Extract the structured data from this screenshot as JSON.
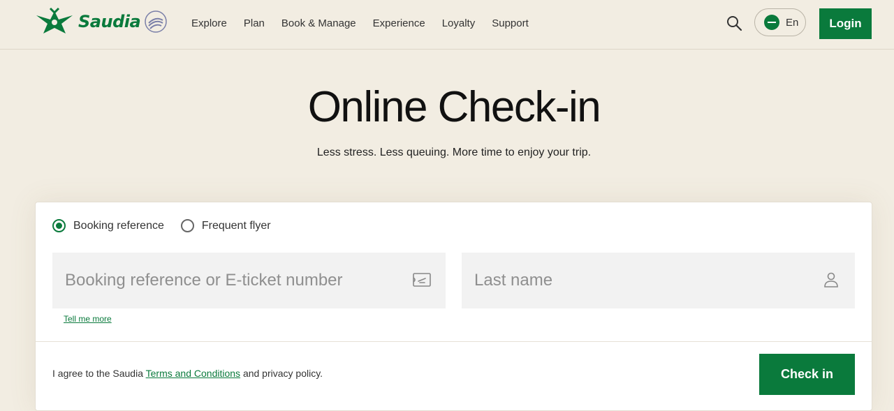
{
  "header": {
    "brand": "Saudia",
    "nav": [
      "Explore",
      "Plan",
      "Book & Manage",
      "Experience",
      "Loyalty",
      "Support"
    ],
    "language": "En",
    "login_label": "Login"
  },
  "hero": {
    "title": "Online Check-in",
    "subtitle": "Less stress. Less queuing. More time to enjoy your trip."
  },
  "form": {
    "options": [
      {
        "label": "Booking reference",
        "selected": true
      },
      {
        "label": "Frequent flyer",
        "selected": false
      }
    ],
    "booking_placeholder": "Booking reference or E-ticket number",
    "lastname_placeholder": "Last name",
    "tell_more": "Tell me more",
    "agree_prefix": "I agree to the Saudia",
    "terms_link": "Terms and Conditions",
    "agree_suffix": "and privacy policy.",
    "checkin_label": "Check in"
  },
  "colors": {
    "brand_green": "#0a7a3c",
    "background": "#f2ede2",
    "field_bg": "#f2f2f2"
  },
  "icons": [
    "saudia-logo-icon",
    "skyteam-icon",
    "search-icon",
    "flag-icon",
    "ticket-icon",
    "user-icon"
  ]
}
